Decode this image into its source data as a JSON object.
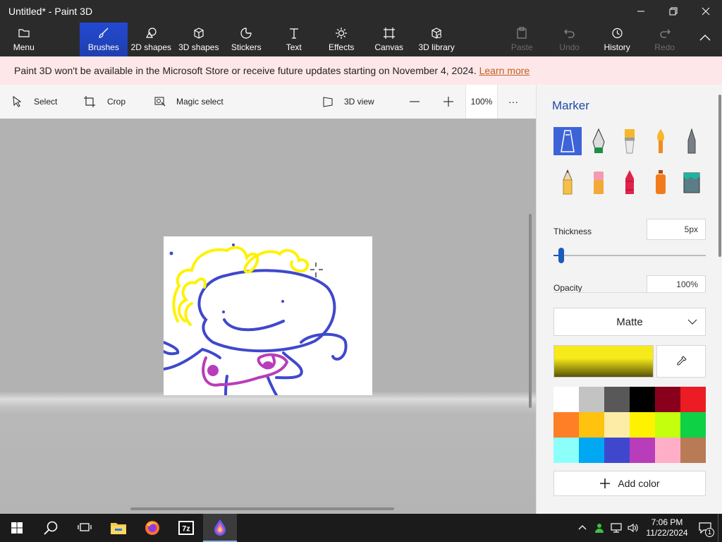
{
  "window": {
    "title": "Untitled* - Paint 3D"
  },
  "toolbar": {
    "menu": "Menu",
    "brushes": "Brushes",
    "shapes2d": "2D shapes",
    "shapes3d": "3D shapes",
    "stickers": "Stickers",
    "text": "Text",
    "effects": "Effects",
    "canvas": "Canvas",
    "library3d": "3D library",
    "paste": "Paste",
    "undo": "Undo",
    "history": "History",
    "redo": "Redo"
  },
  "notice": {
    "message": "Paint 3D won't be available in the Microsoft Store or receive future updates starting on November 4, 2024.",
    "link": "Learn more"
  },
  "subbar": {
    "select": "Select",
    "crop": "Crop",
    "magic_select": "Magic select",
    "view3d": "3D view",
    "zoom": "100%",
    "more": "···"
  },
  "panel": {
    "title": "Marker",
    "thickness_label": "Thickness",
    "thickness_value": "5px",
    "thickness_fraction": 0.05,
    "opacity_label": "Opacity",
    "opacity_value": "100%",
    "finish": "Matte",
    "add_color": "Add color",
    "current_color": "#f7ea1a",
    "palette": [
      "#ffffff",
      "#c3c3c3",
      "#585858",
      "#000000",
      "#88001b",
      "#ec1c24",
      "#ff7f27",
      "#ffc20e",
      "#fdeca6",
      "#fff200",
      "#c4ff0e",
      "#0ed145",
      "#8cfffb",
      "#00a8f3",
      "#3f48cc",
      "#b83dba",
      "#ffaec8",
      "#b97a56"
    ]
  },
  "taskbar": {
    "time": "7:06 PM",
    "date": "11/22/2024",
    "notifications": "1"
  }
}
